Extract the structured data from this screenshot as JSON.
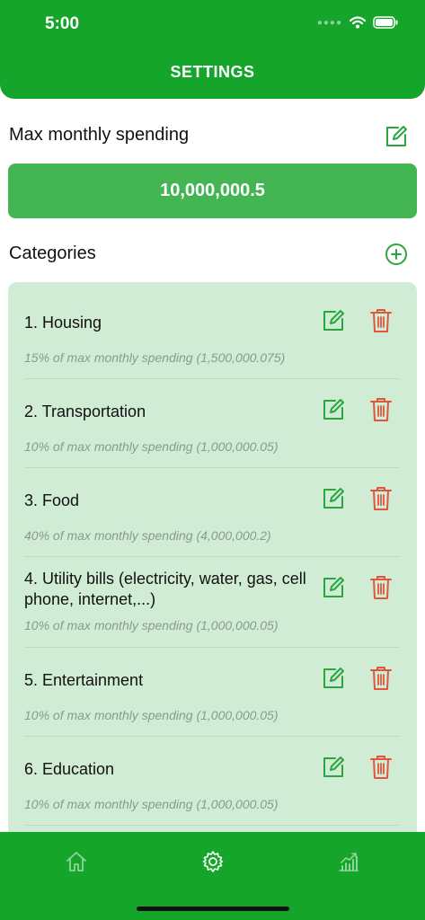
{
  "status_bar": {
    "time": "5:00"
  },
  "header": {
    "title": "SETTINGS"
  },
  "max_spending": {
    "label": "Max monthly spending",
    "value": "10,000,000.5"
  },
  "categories": {
    "label": "Categories",
    "items": [
      {
        "name": "1. Housing",
        "detail": "15% of max monthly spending (1,500,000.075)"
      },
      {
        "name": "2. Transportation",
        "detail": "10% of max monthly spending (1,000,000.05)"
      },
      {
        "name": "3. Food",
        "detail": "40% of max monthly spending (4,000,000.2)"
      },
      {
        "name": "4. Utility bills (electricity, water, gas, cell phone, internet,...)",
        "detail": "10% of max monthly spending (1,000,000.05)"
      },
      {
        "name": "5. Entertainment",
        "detail": "10% of max monthly spending (1,000,000.05)"
      },
      {
        "name": "6. Education",
        "detail": "10% of max monthly spending (1,000,000.05)"
      }
    ]
  },
  "tabs": [
    {
      "icon": "home-icon",
      "active": false
    },
    {
      "icon": "gear-icon",
      "active": true
    },
    {
      "icon": "chart-icon",
      "active": false
    }
  ],
  "colors": {
    "primary": "#14a52a",
    "value_bg": "#44b553",
    "panel_bg": "#d1ecd5",
    "edit": "#2aa63e",
    "delete": "#e0553e"
  }
}
